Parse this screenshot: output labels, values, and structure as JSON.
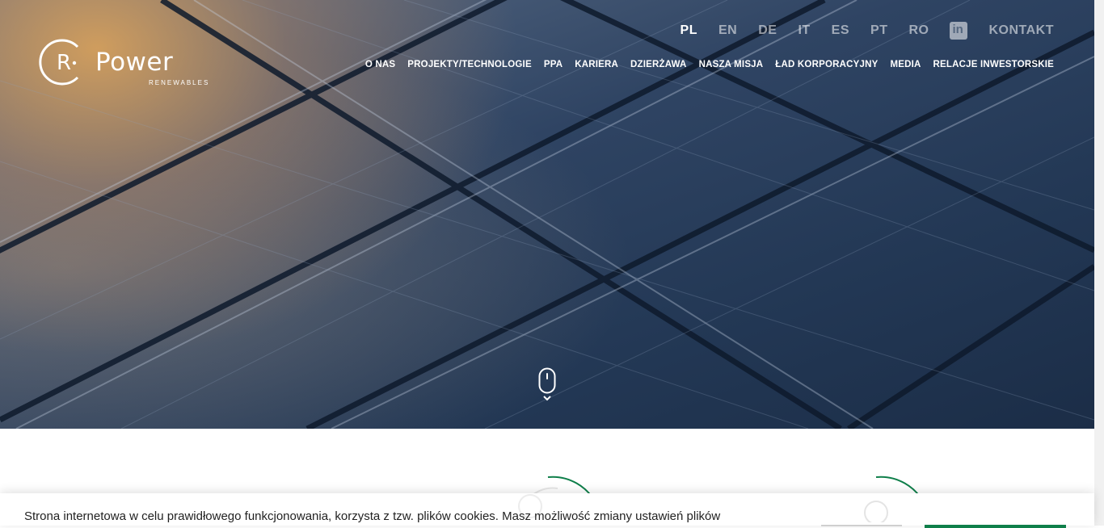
{
  "brand": {
    "name": "Power",
    "initial": "R",
    "tagline": "RENEWABLES"
  },
  "languages": [
    {
      "code": "PL",
      "active": true
    },
    {
      "code": "EN",
      "active": false
    },
    {
      "code": "DE",
      "active": false
    },
    {
      "code": "IT",
      "active": false
    },
    {
      "code": "ES",
      "active": false
    },
    {
      "code": "PT",
      "active": false
    },
    {
      "code": "RO",
      "active": false
    }
  ],
  "social": {
    "linkedin_icon": "linkedin-icon",
    "linkedin_label": "in"
  },
  "contact_label": "KONTAKT",
  "nav": {
    "items": [
      "O NAS",
      "PROJEKTY/TECHNOLOGIE",
      "PPA",
      "KARIERA",
      "DZIERŻAWA",
      "NASZA MISJA",
      "ŁAD KORPORACYJNY",
      "MEDIA",
      "RELACJE INWESTORSKIE"
    ]
  },
  "hero": {
    "scroll_icon": "mouse-scroll-icon"
  },
  "cookie": {
    "text": "Strona internetowa w celu prawidłowego funkcjonowania, korzysta z tzw. plików cookies. Masz możliwość zmiany ustawień plików"
  },
  "colors": {
    "accent": "#0f7f4a",
    "hero_dark": "#233855",
    "hero_warm": "#d6a05c"
  }
}
